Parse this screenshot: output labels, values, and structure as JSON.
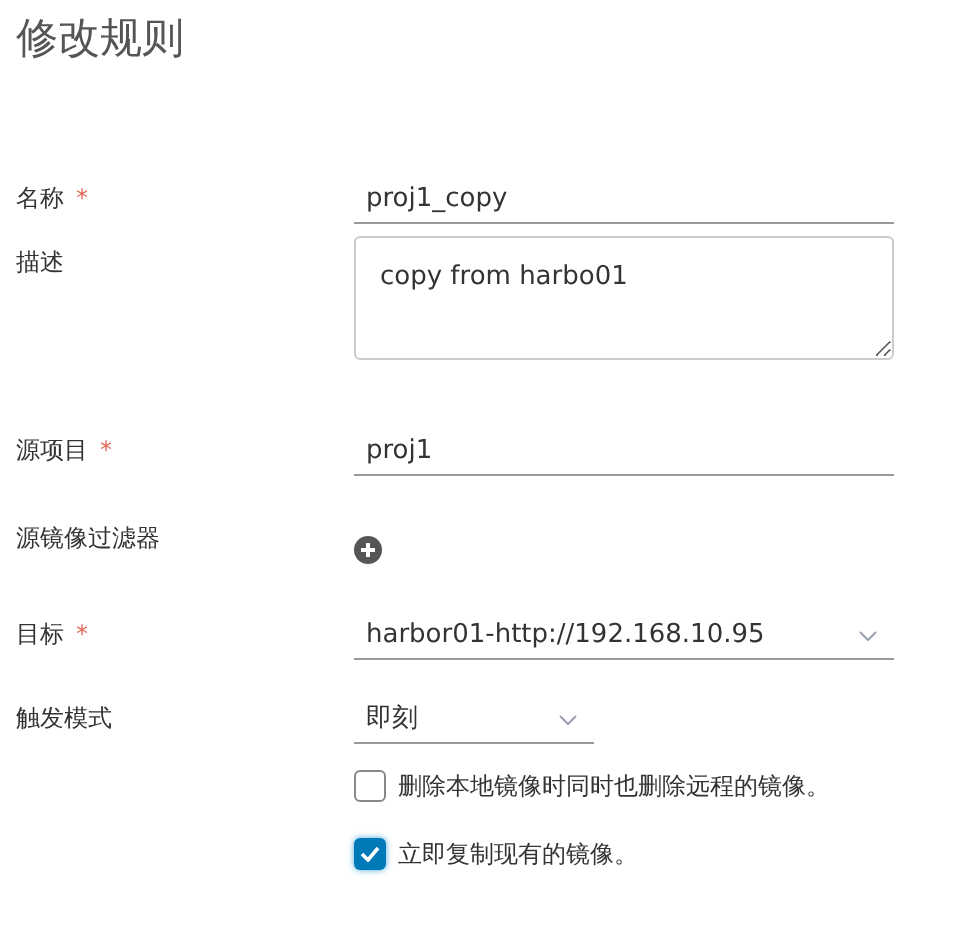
{
  "title": "修改规则",
  "fields": [
    {
      "kind": "text",
      "label": "名称",
      "required_mark": "*",
      "value": "proj1_copy"
    },
    {
      "kind": "textarea",
      "label": "描述",
      "value": "copy from harbo01"
    },
    {
      "kind": "text",
      "label": "源项目",
      "required_mark": "*",
      "value": "proj1"
    },
    {
      "kind": "add",
      "label": "源镜像过滤器"
    },
    {
      "kind": "select",
      "label": "目标",
      "required_mark": "*",
      "value": "harbor01-http://192.168.10.95"
    },
    {
      "kind": "select_short",
      "label": "触发模式",
      "value": "即刻"
    }
  ],
  "options": [
    {
      "label": "删除本地镜像时同时也删除远程的镜像。",
      "checked": false
    },
    {
      "label": "立即复制现有的镜像。",
      "checked": true
    }
  ]
}
